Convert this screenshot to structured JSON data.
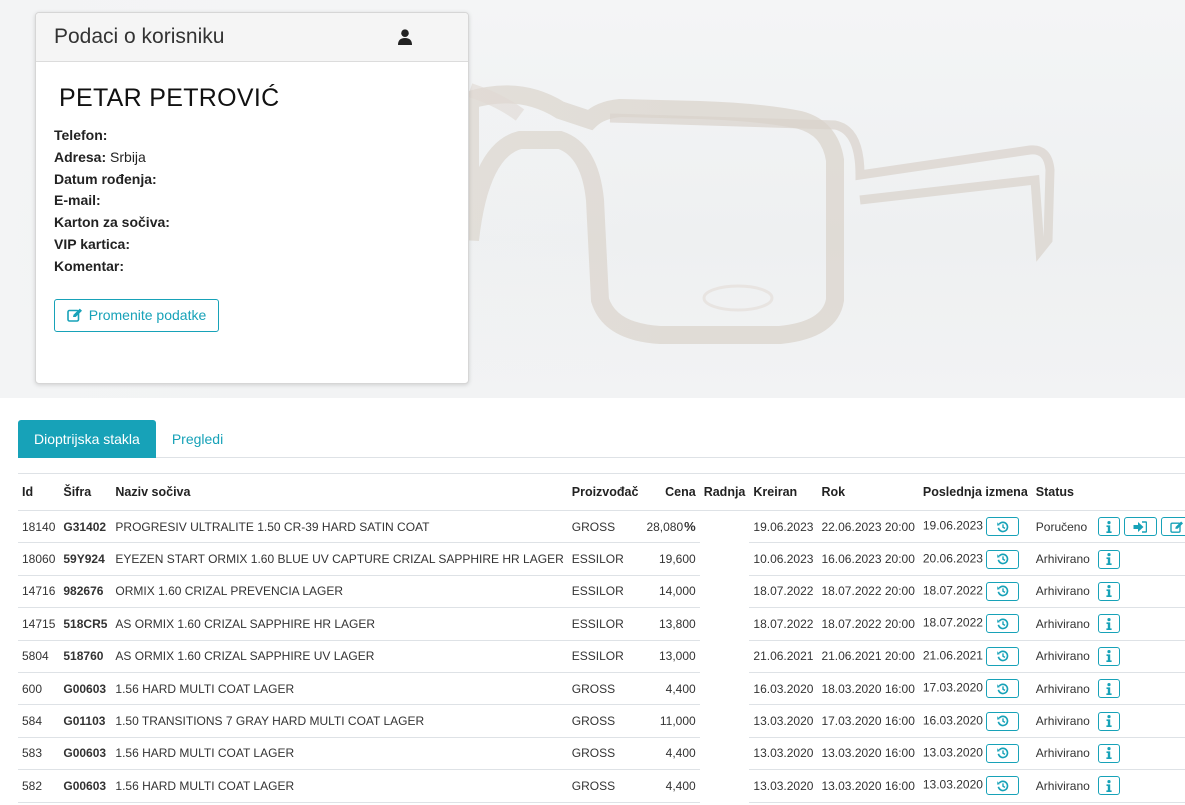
{
  "card": {
    "title": "Podaci o korisniku",
    "icon": "user-icon",
    "name": "PETAR PETROVIĆ",
    "fields": [
      {
        "label": "Telefon:",
        "value": ""
      },
      {
        "label": "Adresa:",
        "value": "Srbija"
      },
      {
        "label": "Datum rođenja:",
        "value": ""
      },
      {
        "label": "E-mail:",
        "value": ""
      },
      {
        "label": "Karton za sočiva:",
        "value": ""
      },
      {
        "label": "VIP kartica:",
        "value": ""
      },
      {
        "label": "Komentar:",
        "value": ""
      }
    ],
    "edit_label": "Promenite podatke"
  },
  "tabs": [
    {
      "label": "Dioptrijska stakla",
      "active": true
    },
    {
      "label": "Pregledi",
      "active": false
    }
  ],
  "table": {
    "headers": {
      "id": "Id",
      "code": "Šifra",
      "name": "Naziv sočiva",
      "maker": "Proizvođač",
      "price": "Cena",
      "shop": "Radnja",
      "created": "Kreiran",
      "due": "Rok",
      "modified": "Poslednja izmena",
      "status": "Status"
    },
    "rows": [
      {
        "id": "18140",
        "code": "G31402",
        "name": "PROGRESIV ULTRALITE 1.50 CR-39 HARD SATIN COAT",
        "maker": "GROSS",
        "price": "28,080",
        "pct": "%",
        "shop": "",
        "created": "19.06.2023",
        "due": "22.06.2023 20:00",
        "modified": "19.06.2023",
        "status": "Poručeno",
        "actions": [
          "info",
          "send",
          "edit"
        ]
      },
      {
        "id": "18060",
        "code": "59Y924",
        "name": "EYEZEN START ORMIX 1.60 BLUE UV CAPTURE CRIZAL SAPPHIRE HR LAGER",
        "maker": "ESSILOR",
        "price": "19,600",
        "pct": "",
        "shop": "",
        "created": "10.06.2023",
        "due": "16.06.2023 20:00",
        "modified": "20.06.2023",
        "status": "Arhivirano",
        "actions": [
          "info"
        ]
      },
      {
        "id": "14716",
        "code": "982676",
        "name": "ORMIX 1.60 CRIZAL PREVENCIA LAGER",
        "maker": "ESSILOR",
        "price": "14,000",
        "pct": "",
        "shop": "",
        "created": "18.07.2022",
        "due": "18.07.2022 20:00",
        "modified": "18.07.2022",
        "status": "Arhivirano",
        "actions": [
          "info"
        ]
      },
      {
        "id": "14715",
        "code": "518CR5",
        "name": "AS ORMIX 1.60 CRIZAL SAPPHIRE HR LAGER",
        "maker": "ESSILOR",
        "price": "13,800",
        "pct": "",
        "shop": "",
        "created": "18.07.2022",
        "due": "18.07.2022 20:00",
        "modified": "18.07.2022",
        "status": "Arhivirano",
        "actions": [
          "info"
        ]
      },
      {
        "id": "5804",
        "code": "518760",
        "name": "AS ORMIX 1.60 CRIZAL SAPPHIRE UV LAGER",
        "maker": "ESSILOR",
        "price": "13,000",
        "pct": "",
        "shop": "",
        "created": "21.06.2021",
        "due": "21.06.2021 20:00",
        "modified": "21.06.2021",
        "status": "Arhivirano",
        "actions": [
          "info"
        ]
      },
      {
        "id": "600",
        "code": "G00603",
        "name": "1.56 HARD MULTI COAT LAGER",
        "maker": "GROSS",
        "price": "4,400",
        "pct": "",
        "shop": "",
        "created": "16.03.2020",
        "due": "18.03.2020 16:00",
        "modified": "17.03.2020",
        "status": "Arhivirano",
        "actions": [
          "info"
        ]
      },
      {
        "id": "584",
        "code": "G01103",
        "name": "1.50 TRANSITIONS 7 GRAY HARD MULTI COAT LAGER",
        "maker": "GROSS",
        "price": "11,000",
        "pct": "",
        "shop": "",
        "created": "13.03.2020",
        "due": "17.03.2020 16:00",
        "modified": "16.03.2020",
        "status": "Arhivirano",
        "actions": [
          "info"
        ]
      },
      {
        "id": "583",
        "code": "G00603",
        "name": "1.56 HARD MULTI COAT LAGER",
        "maker": "GROSS",
        "price": "4,400",
        "pct": "",
        "shop": "",
        "created": "13.03.2020",
        "due": "13.03.2020 16:00",
        "modified": "13.03.2020",
        "status": "Arhivirano",
        "actions": [
          "info"
        ]
      },
      {
        "id": "582",
        "code": "G00603",
        "name": "1.56 HARD MULTI COAT LAGER",
        "maker": "GROSS",
        "price": "4,400",
        "pct": "",
        "shop": "",
        "created": "13.03.2020",
        "due": "13.03.2020 16:00",
        "modified": "13.03.2020",
        "status": "Arhivirano",
        "actions": [
          "info"
        ]
      }
    ]
  },
  "colors": {
    "accent": "#17a2b8"
  }
}
